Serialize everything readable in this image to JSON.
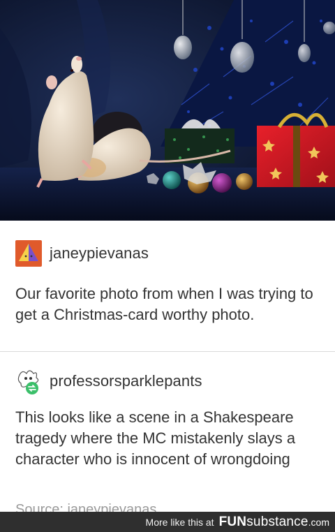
{
  "photo": {
    "alt": ""
  },
  "post1": {
    "username": "janeypievanas",
    "text": "Our favorite photo from when I was trying to get a Christmas-card worthy photo."
  },
  "post2": {
    "username": "professorsparklepants",
    "text": "This looks like a scene in a Shakespeare tragedy where the MC mistakenly slays a character who is innocent of wrongdoing",
    "source": "Source: janeypievanas"
  },
  "footer": {
    "more_text": "More like this at",
    "brand_bold": "FUN",
    "brand_sub": "substance",
    "brand_domain": ".com"
  },
  "colors": {
    "footer_bg": "#2f2f2f",
    "avatar1_bg": "#e05a2b",
    "avatar2_accent": "#3bbf6a"
  },
  "icons": {
    "avatar1": "pyramid-avatar-icon",
    "avatar2": "reblog-badge-icon"
  }
}
